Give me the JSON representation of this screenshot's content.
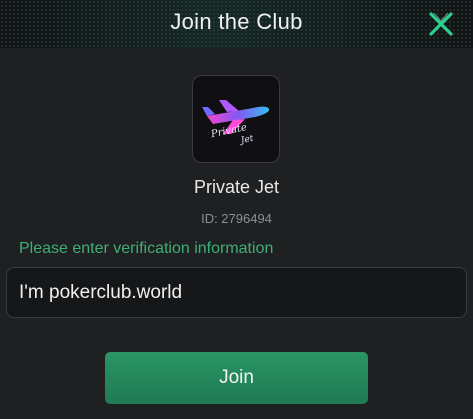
{
  "dialog": {
    "title": "Join the Club",
    "close_icon": "close-x-icon"
  },
  "club": {
    "logo_text_line1": "Private",
    "logo_text_line2": "Jet",
    "name": "Private Jet",
    "id_label": "ID: 2796494"
  },
  "form": {
    "prompt": "Please enter verification information",
    "input_value": "I'm pokerclub.world"
  },
  "actions": {
    "join_label": "Join"
  },
  "colors": {
    "accent_green": "#3fae78",
    "button_green": "#1f7a53",
    "close_icon": "#2ecf8f",
    "background": "#1f2022"
  }
}
